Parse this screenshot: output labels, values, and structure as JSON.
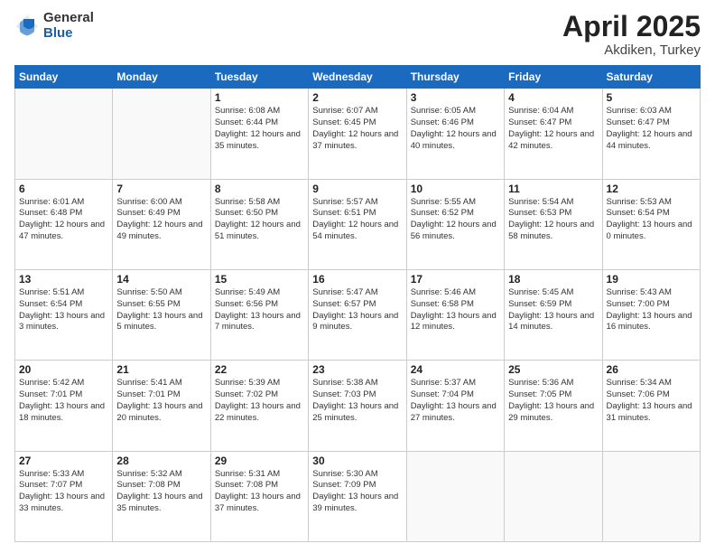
{
  "header": {
    "logo_general": "General",
    "logo_blue": "Blue",
    "title": "April 2025",
    "location": "Akdiken, Turkey"
  },
  "weekdays": [
    "Sunday",
    "Monday",
    "Tuesday",
    "Wednesday",
    "Thursday",
    "Friday",
    "Saturday"
  ],
  "weeks": [
    [
      {
        "day": "",
        "text": ""
      },
      {
        "day": "",
        "text": ""
      },
      {
        "day": "1",
        "text": "Sunrise: 6:08 AM\nSunset: 6:44 PM\nDaylight: 12 hours\nand 35 minutes."
      },
      {
        "day": "2",
        "text": "Sunrise: 6:07 AM\nSunset: 6:45 PM\nDaylight: 12 hours\nand 37 minutes."
      },
      {
        "day": "3",
        "text": "Sunrise: 6:05 AM\nSunset: 6:46 PM\nDaylight: 12 hours\nand 40 minutes."
      },
      {
        "day": "4",
        "text": "Sunrise: 6:04 AM\nSunset: 6:47 PM\nDaylight: 12 hours\nand 42 minutes."
      },
      {
        "day": "5",
        "text": "Sunrise: 6:03 AM\nSunset: 6:47 PM\nDaylight: 12 hours\nand 44 minutes."
      }
    ],
    [
      {
        "day": "6",
        "text": "Sunrise: 6:01 AM\nSunset: 6:48 PM\nDaylight: 12 hours\nand 47 minutes."
      },
      {
        "day": "7",
        "text": "Sunrise: 6:00 AM\nSunset: 6:49 PM\nDaylight: 12 hours\nand 49 minutes."
      },
      {
        "day": "8",
        "text": "Sunrise: 5:58 AM\nSunset: 6:50 PM\nDaylight: 12 hours\nand 51 minutes."
      },
      {
        "day": "9",
        "text": "Sunrise: 5:57 AM\nSunset: 6:51 PM\nDaylight: 12 hours\nand 54 minutes."
      },
      {
        "day": "10",
        "text": "Sunrise: 5:55 AM\nSunset: 6:52 PM\nDaylight: 12 hours\nand 56 minutes."
      },
      {
        "day": "11",
        "text": "Sunrise: 5:54 AM\nSunset: 6:53 PM\nDaylight: 12 hours\nand 58 minutes."
      },
      {
        "day": "12",
        "text": "Sunrise: 5:53 AM\nSunset: 6:54 PM\nDaylight: 13 hours\nand 0 minutes."
      }
    ],
    [
      {
        "day": "13",
        "text": "Sunrise: 5:51 AM\nSunset: 6:54 PM\nDaylight: 13 hours\nand 3 minutes."
      },
      {
        "day": "14",
        "text": "Sunrise: 5:50 AM\nSunset: 6:55 PM\nDaylight: 13 hours\nand 5 minutes."
      },
      {
        "day": "15",
        "text": "Sunrise: 5:49 AM\nSunset: 6:56 PM\nDaylight: 13 hours\nand 7 minutes."
      },
      {
        "day": "16",
        "text": "Sunrise: 5:47 AM\nSunset: 6:57 PM\nDaylight: 13 hours\nand 9 minutes."
      },
      {
        "day": "17",
        "text": "Sunrise: 5:46 AM\nSunset: 6:58 PM\nDaylight: 13 hours\nand 12 minutes."
      },
      {
        "day": "18",
        "text": "Sunrise: 5:45 AM\nSunset: 6:59 PM\nDaylight: 13 hours\nand 14 minutes."
      },
      {
        "day": "19",
        "text": "Sunrise: 5:43 AM\nSunset: 7:00 PM\nDaylight: 13 hours\nand 16 minutes."
      }
    ],
    [
      {
        "day": "20",
        "text": "Sunrise: 5:42 AM\nSunset: 7:01 PM\nDaylight: 13 hours\nand 18 minutes."
      },
      {
        "day": "21",
        "text": "Sunrise: 5:41 AM\nSunset: 7:01 PM\nDaylight: 13 hours\nand 20 minutes."
      },
      {
        "day": "22",
        "text": "Sunrise: 5:39 AM\nSunset: 7:02 PM\nDaylight: 13 hours\nand 22 minutes."
      },
      {
        "day": "23",
        "text": "Sunrise: 5:38 AM\nSunset: 7:03 PM\nDaylight: 13 hours\nand 25 minutes."
      },
      {
        "day": "24",
        "text": "Sunrise: 5:37 AM\nSunset: 7:04 PM\nDaylight: 13 hours\nand 27 minutes."
      },
      {
        "day": "25",
        "text": "Sunrise: 5:36 AM\nSunset: 7:05 PM\nDaylight: 13 hours\nand 29 minutes."
      },
      {
        "day": "26",
        "text": "Sunrise: 5:34 AM\nSunset: 7:06 PM\nDaylight: 13 hours\nand 31 minutes."
      }
    ],
    [
      {
        "day": "27",
        "text": "Sunrise: 5:33 AM\nSunset: 7:07 PM\nDaylight: 13 hours\nand 33 minutes."
      },
      {
        "day": "28",
        "text": "Sunrise: 5:32 AM\nSunset: 7:08 PM\nDaylight: 13 hours\nand 35 minutes."
      },
      {
        "day": "29",
        "text": "Sunrise: 5:31 AM\nSunset: 7:08 PM\nDaylight: 13 hours\nand 37 minutes."
      },
      {
        "day": "30",
        "text": "Sunrise: 5:30 AM\nSunset: 7:09 PM\nDaylight: 13 hours\nand 39 minutes."
      },
      {
        "day": "",
        "text": ""
      },
      {
        "day": "",
        "text": ""
      },
      {
        "day": "",
        "text": ""
      }
    ]
  ]
}
